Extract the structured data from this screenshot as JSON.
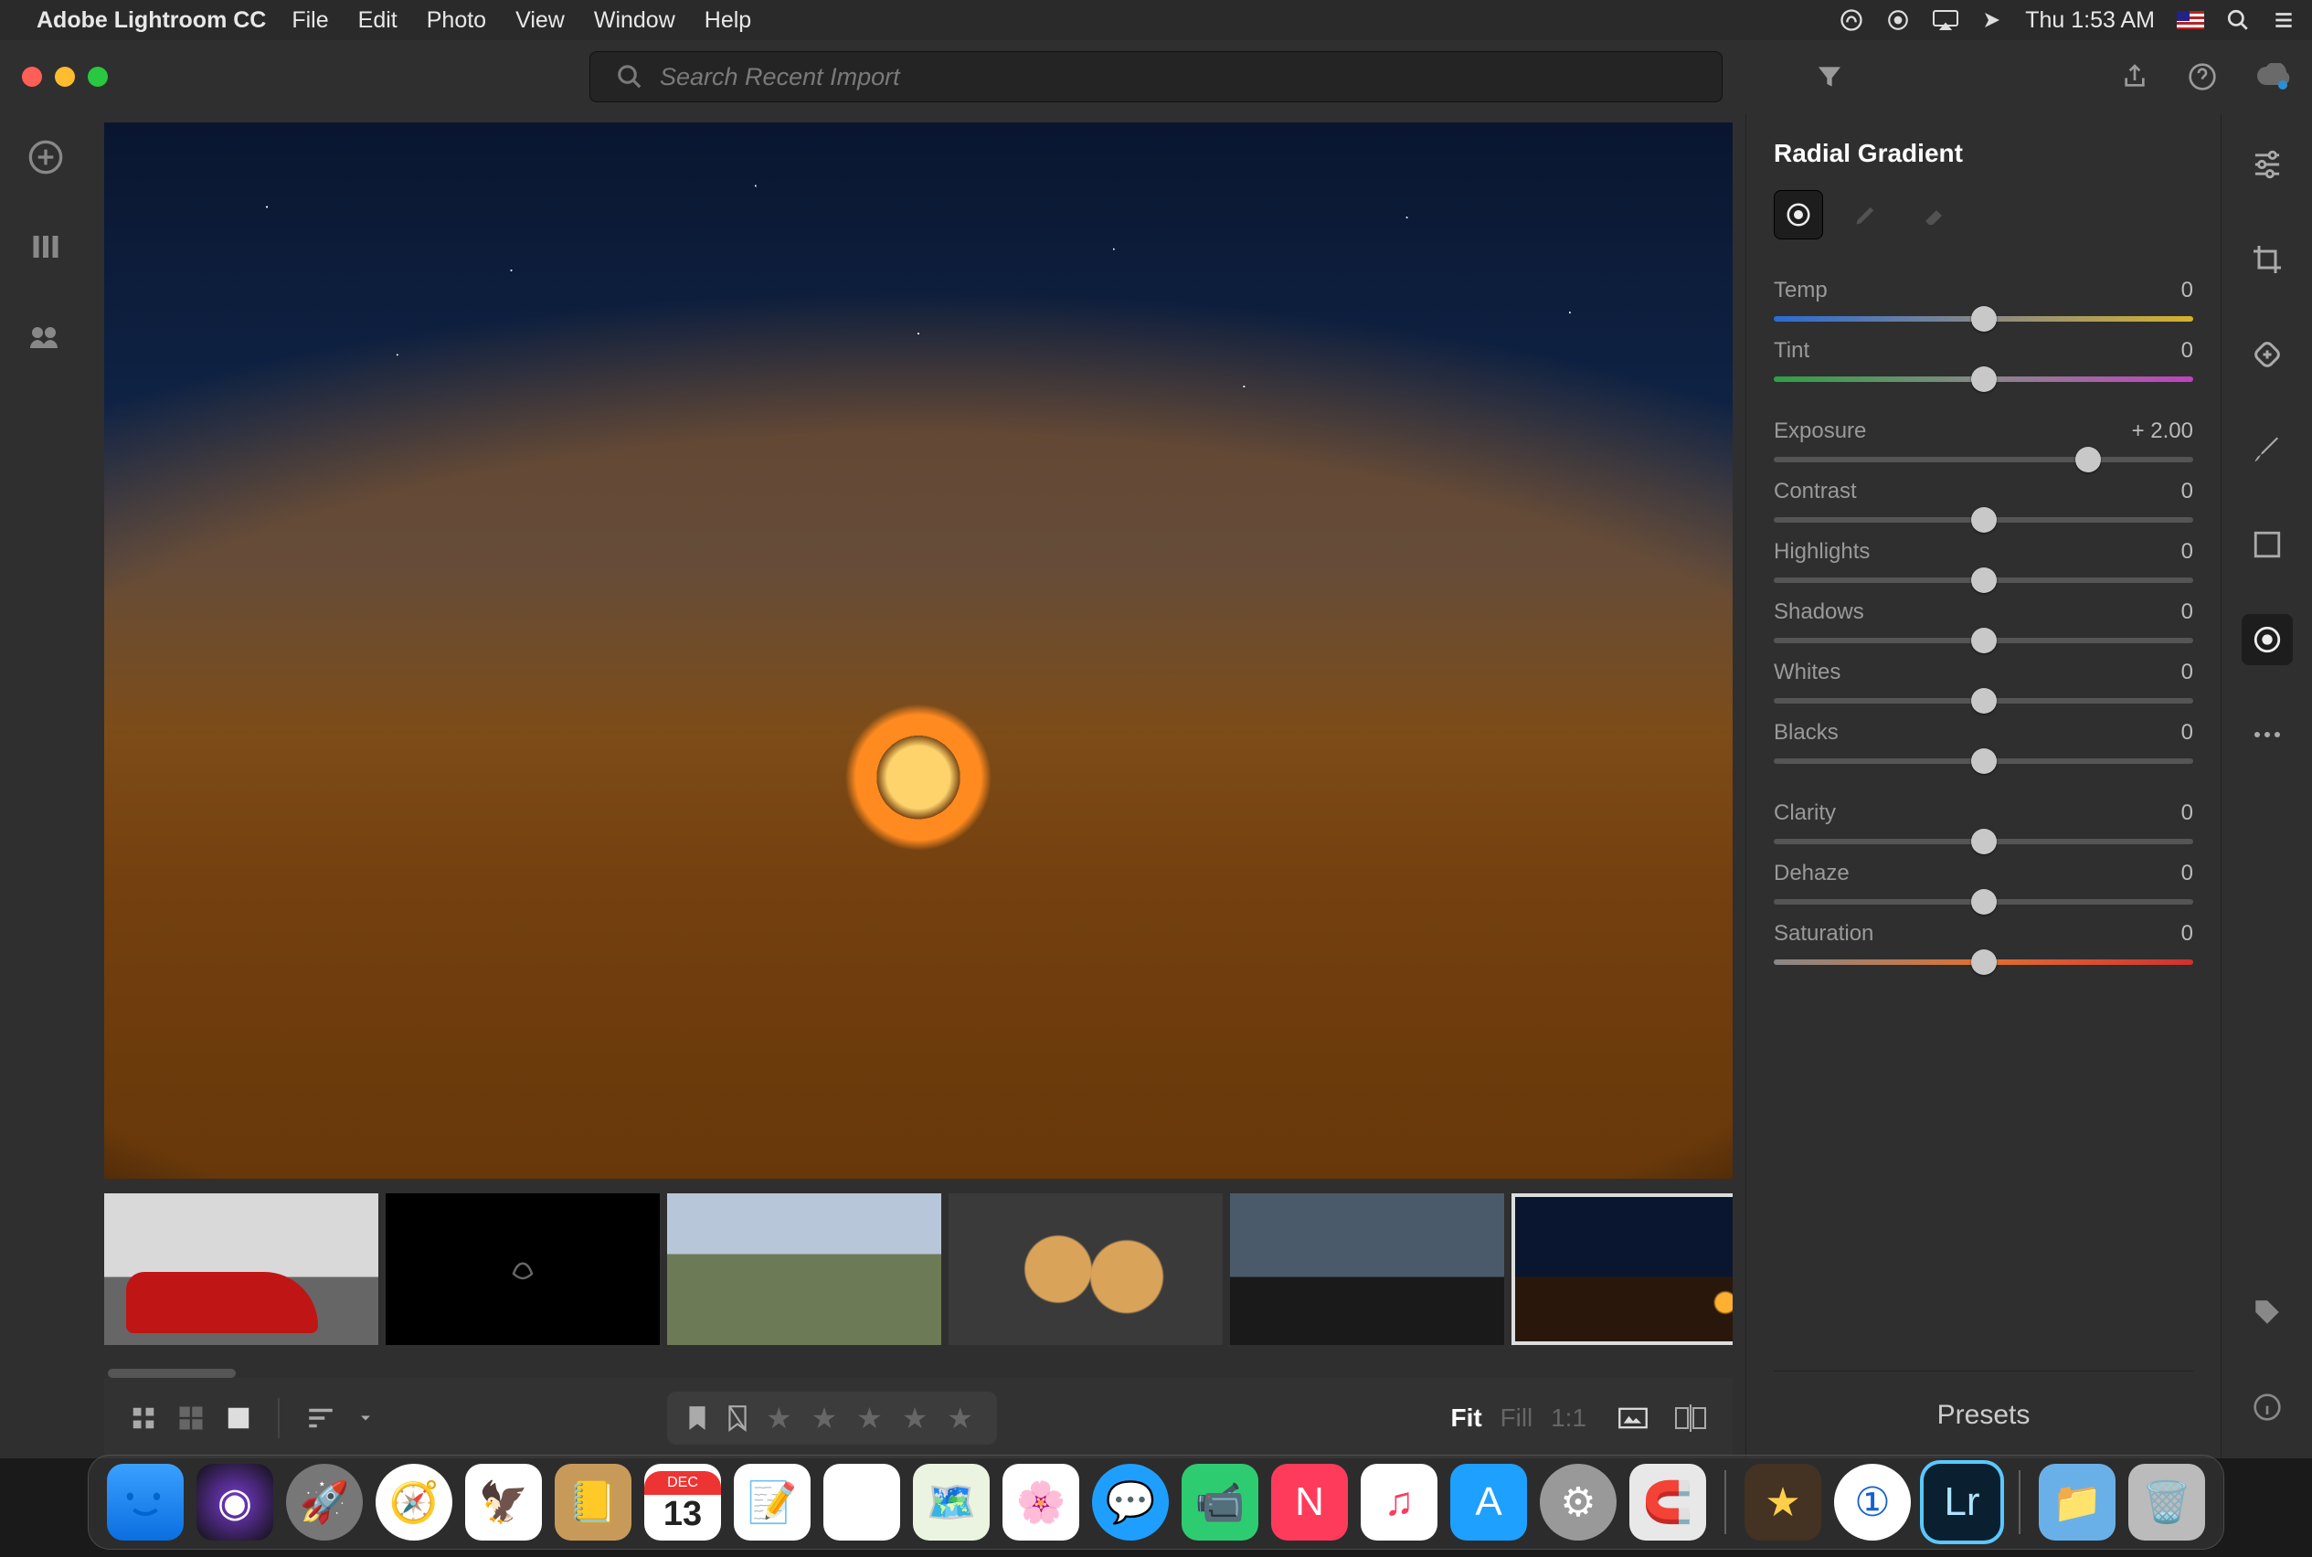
{
  "menubar": {
    "app_name": "Adobe Lightroom CC",
    "items": [
      "File",
      "Edit",
      "Photo",
      "View",
      "Window",
      "Help"
    ],
    "clock": "Thu 1:53 AM"
  },
  "toolbar": {
    "search_placeholder": "Search Recent Import"
  },
  "panel": {
    "title": "Radial Gradient",
    "sliders": [
      {
        "key": "temp",
        "label": "Temp",
        "value": "0",
        "pos": 50,
        "track": "temp"
      },
      {
        "key": "tint",
        "label": "Tint",
        "value": "0",
        "pos": 50,
        "track": "tint"
      },
      {
        "key": "exposure",
        "label": "Exposure",
        "value": "+ 2.00",
        "pos": 75,
        "track": "plain"
      },
      {
        "key": "contrast",
        "label": "Contrast",
        "value": "0",
        "pos": 50,
        "track": "plain"
      },
      {
        "key": "highlights",
        "label": "Highlights",
        "value": "0",
        "pos": 50,
        "track": "plain"
      },
      {
        "key": "shadows",
        "label": "Shadows",
        "value": "0",
        "pos": 50,
        "track": "plain"
      },
      {
        "key": "whites",
        "label": "Whites",
        "value": "0",
        "pos": 50,
        "track": "plain"
      },
      {
        "key": "blacks",
        "label": "Blacks",
        "value": "0",
        "pos": 50,
        "track": "plain"
      },
      {
        "key": "clarity",
        "label": "Clarity",
        "value": "0",
        "pos": 50,
        "track": "plain"
      },
      {
        "key": "dehaze",
        "label": "Dehaze",
        "value": "0",
        "pos": 50,
        "track": "plain"
      },
      {
        "key": "saturation",
        "label": "Saturation",
        "value": "0",
        "pos": 50,
        "track": "sat"
      }
    ],
    "presets_label": "Presets"
  },
  "bottombar": {
    "zoom": {
      "fit": "Fit",
      "fill": "Fill",
      "one": "1:1"
    }
  },
  "dock": {
    "calendar": {
      "month": "DEC",
      "day": "13"
    },
    "lr": "Lr"
  }
}
